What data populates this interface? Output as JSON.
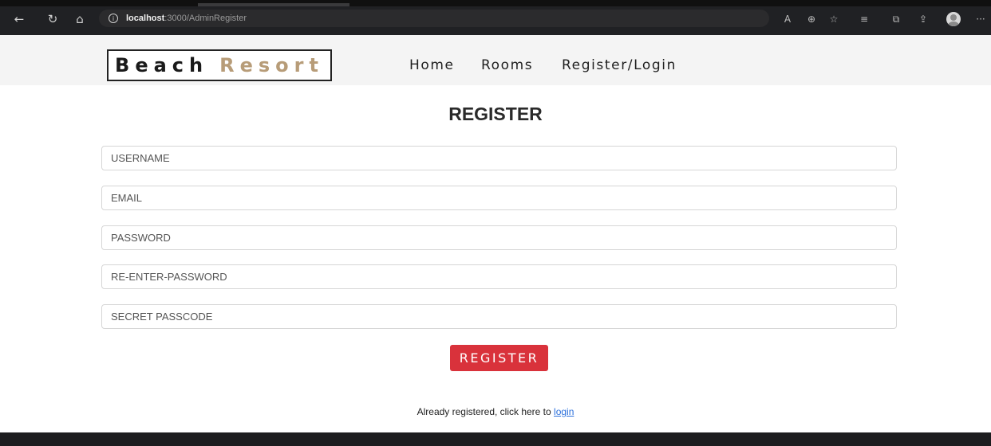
{
  "browser": {
    "url_host": "localhost",
    "url_path": ":3000/AdminRegister",
    "icons": [
      "back-icon",
      "refresh-icon",
      "home-icon",
      "info-icon",
      "read-aloud-icon",
      "zoom-icon",
      "favorite-add-icon",
      "favorites-icon",
      "collections-icon",
      "share-icon",
      "profile-avatar",
      "more-icon"
    ]
  },
  "nav": {
    "brand_part1": "Beach",
    "brand_part2": "Resort",
    "links": [
      "Home",
      "Rooms",
      "Register/Login"
    ]
  },
  "form": {
    "title": "REGISTER",
    "fields": [
      {
        "placeholder": "USERNAME",
        "value": ""
      },
      {
        "placeholder": "EMAIL",
        "value": ""
      },
      {
        "placeholder": "PASSWORD",
        "value": ""
      },
      {
        "placeholder": "RE-ENTER-PASSWORD",
        "value": ""
      },
      {
        "placeholder": "SECRET PASSCODE",
        "value": ""
      }
    ],
    "submit_label": "REGISTER",
    "login_prompt": "Already registered, click here to",
    "login_link": "login"
  },
  "colors": {
    "browser_chrome": "#202124",
    "nav_background": "#f4f4f4",
    "brand_accent": "#b79c78",
    "button": "#d9323b",
    "link": "#2a6fdb",
    "footer": "#1d1d1f"
  }
}
